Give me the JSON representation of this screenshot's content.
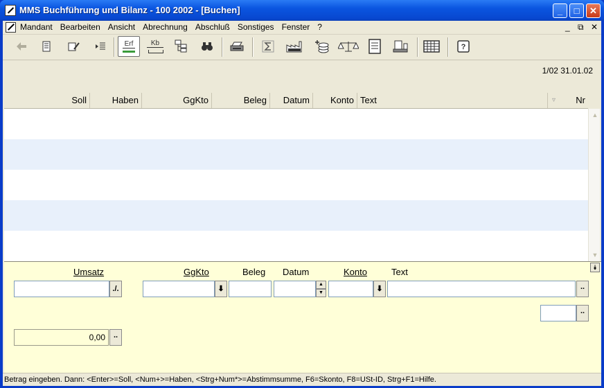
{
  "window": {
    "title": "MMS Buchführung und Bilanz  -  100 2002 - [Buchen]",
    "minimize_label": "_",
    "maximize_label": "□",
    "close_label": "✕"
  },
  "menu": {
    "items": [
      "Mandant",
      "Bearbeiten",
      "Ansicht",
      "Abrechnung",
      "Abschluß",
      "Sonstiges",
      "Fenster",
      "?"
    ],
    "mdi_minimize": "_",
    "mdi_restore": "⧉",
    "mdi_close": "✕"
  },
  "toolbar": {
    "erf_label": "Erf",
    "kb_label": "Kb"
  },
  "infobar": {
    "period": "1/02  31.01.02"
  },
  "grid": {
    "columns": {
      "soll": "Soll",
      "haben": "Haben",
      "ggkto": "GgKto",
      "beleg": "Beleg",
      "datum": "Datum",
      "konto": "Konto",
      "text": "Text",
      "nr": "Nr"
    },
    "sort_indicator": "▿"
  },
  "form": {
    "umsatz_label": "Umsatz",
    "ggkto_label": "GgKto",
    "beleg_label": "Beleg",
    "datum_label": "Datum",
    "konto_label": "Konto",
    "text_label": "Text",
    "umsatz_value": "",
    "ggkto_value": "",
    "beleg_value": "",
    "datum_value": "",
    "konto_value": "",
    "text_value": "",
    "sign_toggle": "./.",
    "dropdown_glyph": "⬇",
    "dots": "..",
    "balance_value": "0,00",
    "collapse_glyph": "⯯"
  },
  "status": {
    "text": "Betrag eingeben. Dann: <Enter>=Soll, <Num+>=Haben, <Strg+Num*>=Abstimmsumme, F6=Skonto, F8=USt-ID, Strg+F1=Hilfe."
  }
}
